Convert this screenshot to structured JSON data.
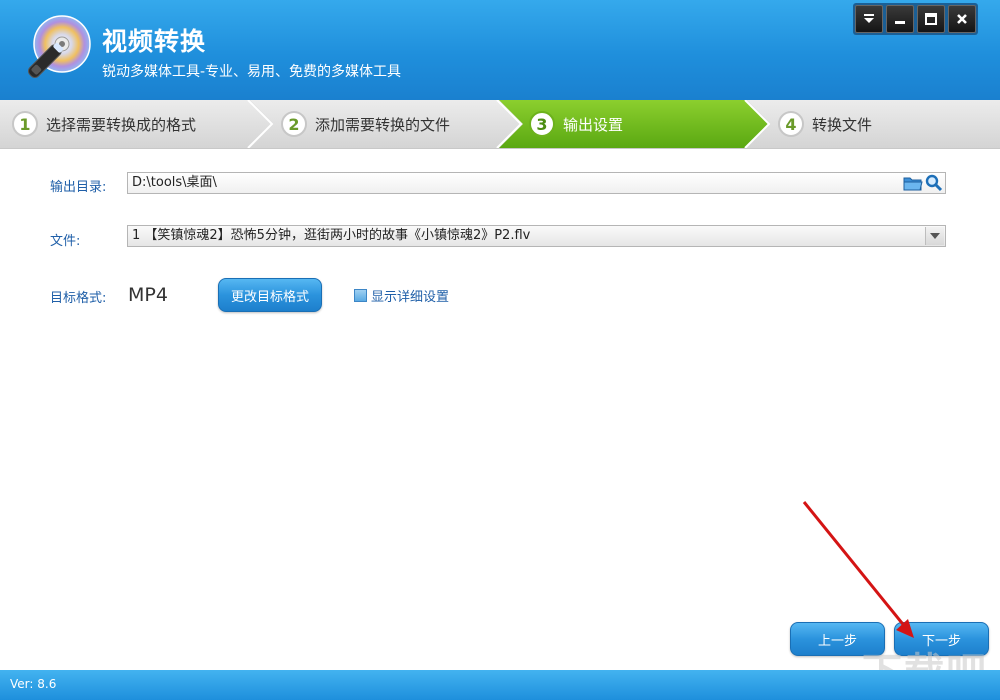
{
  "header": {
    "title": "视频转换",
    "subtitle": "锐动多媒体工具-专业、易用、免费的多媒体工具",
    "logo_icon": "dvd-magic-wand-icon",
    "bg_color": "#1f8fdc"
  },
  "window_controls": [
    {
      "name": "menu",
      "icon": "dropdown-menu-icon"
    },
    {
      "name": "minimize",
      "icon": "minimize-icon"
    },
    {
      "name": "maximize",
      "icon": "maximize-icon"
    },
    {
      "name": "close",
      "icon": "close-icon"
    }
  ],
  "steps": [
    {
      "num": "1",
      "label": "选择需要转换成的格式",
      "active": false
    },
    {
      "num": "2",
      "label": "添加需要转换的文件",
      "active": false
    },
    {
      "num": "3",
      "label": "输出设置",
      "active": true
    },
    {
      "num": "4",
      "label": "转换文件",
      "active": false
    }
  ],
  "active_step_color": "#6cb21c",
  "form": {
    "output_dir_label": "输出目录:",
    "output_dir_value": "D:\\tools\\桌面\\",
    "file_label": "文件:",
    "file_value": "1 【笑镇惊魂2】恐怖5分钟，逛街两小时的故事《小镇惊魂2》P2.flv",
    "target_format_label": "目标格式:",
    "target_format_value": "MP4",
    "change_format_button": "更改目标格式",
    "show_details_checkbox": "显示详细设置",
    "show_details_checked": false
  },
  "buttons": {
    "prev": "上一步",
    "next": "下一步"
  },
  "footer": {
    "version": "Ver: 8.6"
  },
  "watermark": "下载吧"
}
